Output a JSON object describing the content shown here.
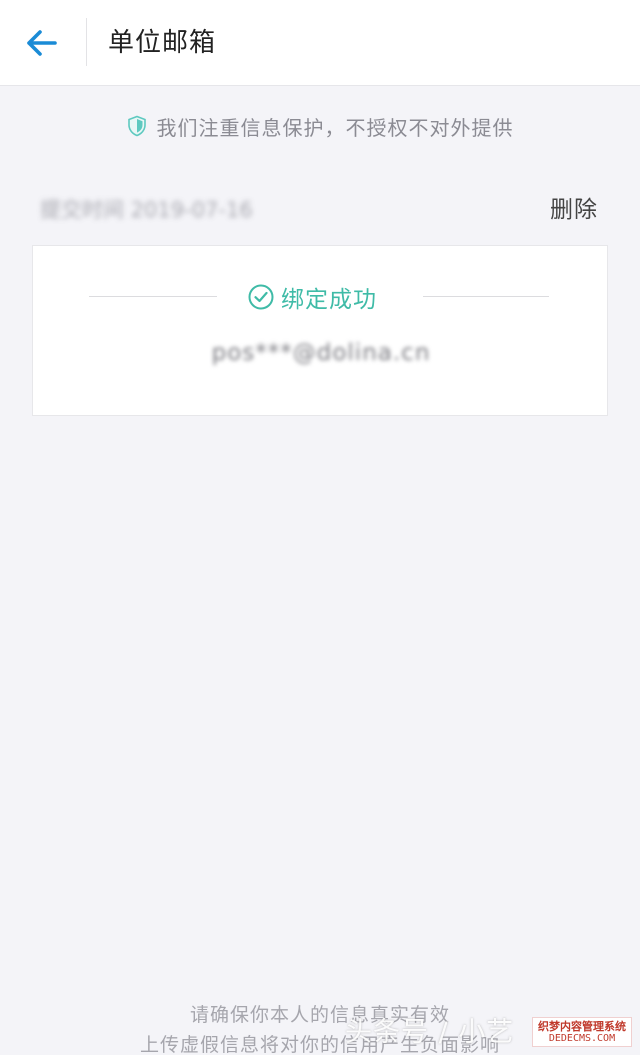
{
  "header": {
    "back_icon": "arrow-left-icon",
    "title": "单位邮箱"
  },
  "notice": {
    "icon": "shield-icon",
    "text": "我们注重信息保护，不授权不对外提供"
  },
  "submission": {
    "time_text": "提交时间 2019-07-16",
    "delete_label": "删除"
  },
  "binding_card": {
    "status_icon": "check-circle-icon",
    "status_text": "绑定成功",
    "email": "pos***@dolina.cn"
  },
  "footer": {
    "line1": "请确保你本人的信息真实有效",
    "line2": "上传虚假信息将对你的信用产生负面影响"
  },
  "watermark": {
    "text": "头条号 / 小艺",
    "badge_top": "织梦内容管理系统",
    "badge_bottom": "DEDECMS.COM"
  },
  "colors": {
    "accent_blue": "#1a8bd6",
    "success_green": "#3fbba7",
    "shield_teal": "#5ec9c0",
    "background": "#f4f4f8"
  }
}
